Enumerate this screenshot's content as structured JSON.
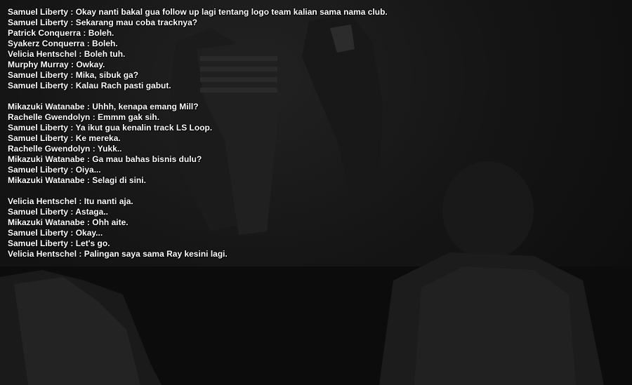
{
  "chat": {
    "groups": [
      [
        "Samuel Liberty : Okay nanti bakal gua follow up lagi tentang logo team kalian sama nama club.",
        "Samuel Liberty : Sekarang mau coba tracknya?",
        "Patrick Conquerra : Boleh.",
        "Syakerz Conquerra : Boleh.",
        "Velicia Hentschel : Boleh tuh.",
        "Murphy Murray : Owkay.",
        "Samuel Liberty : Mika, sibuk ga?",
        "Samuel Liberty : Kalau Rach pasti gabut."
      ],
      [
        "Mikazuki Watanabe : Uhhh, kenapa emang Mill?",
        "Rachelle Gwendolyn : Emmm gak sih.",
        "Samuel Liberty : Ya ikut gua kenalin track LS Loop.",
        "Samuel Liberty : Ke mereka.",
        "Rachelle Gwendolyn : Yukk..",
        "Mikazuki Watanabe : Ga mau bahas bisnis dulu?",
        "Samuel Liberty : Oiya...",
        "Mikazuki Watanabe : Selagi di sini."
      ],
      [
        "Velicia Hentschel : Itu nanti aja.",
        "Samuel Liberty : Astaga..",
        "Mikazuki Watanabe : Ohh aite.",
        "Samuel Liberty : Okay...",
        "Samuel Liberty : Let's go.",
        "Velicia Hentschel : Palingan saya sama Ray kesini lagi."
      ]
    ]
  },
  "scene": {
    "background_color": "#0e0e0e",
    "figure_color": "#1c1c1c",
    "shirt_color": "#2e2e2e",
    "text_color": "#ffffff"
  }
}
